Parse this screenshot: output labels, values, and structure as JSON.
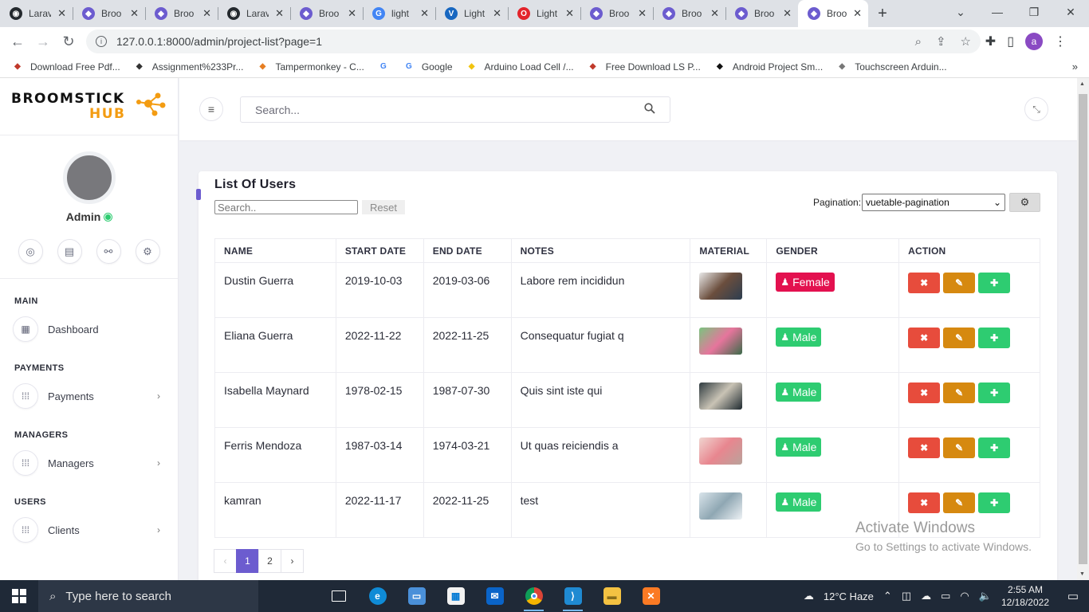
{
  "browser": {
    "tabs": [
      {
        "title": "Larav",
        "icon": "github-icon",
        "color": "#24292e"
      },
      {
        "title": "Broo",
        "icon": "broomstick-icon",
        "color": "#6c5ccf"
      },
      {
        "title": "Broo",
        "icon": "broomstick-icon",
        "color": "#6c5ccf"
      },
      {
        "title": "Larav",
        "icon": "github-icon",
        "color": "#24292e"
      },
      {
        "title": "Broo",
        "icon": "broomstick-icon",
        "color": "#6c5ccf"
      },
      {
        "title": "light",
        "icon": "google-icon",
        "color": "#4285f4"
      },
      {
        "title": "Light",
        "icon": "vuetify-icon",
        "color": "#1867c0"
      },
      {
        "title": "Light",
        "icon": "opera-icon",
        "color": "#e3242b"
      },
      {
        "title": "Broo",
        "icon": "broomstick-icon",
        "color": "#6c5ccf"
      },
      {
        "title": "Broo",
        "icon": "broomstick-icon",
        "color": "#6c5ccf"
      },
      {
        "title": "Broo",
        "icon": "broomstick-icon",
        "color": "#6c5ccf"
      },
      {
        "title": "Broo",
        "icon": "broomstick-icon",
        "color": "#6c5ccf",
        "active": true
      }
    ],
    "url": "127.0.0.1:8000/admin/project-list?page=1",
    "profile_initial": "a",
    "bookmarks": [
      {
        "label": "Download Free Pdf...",
        "icon": "pdf-icon",
        "color": "#c0392b"
      },
      {
        "label": "Assignment%233Pr...",
        "icon": "globe-icon",
        "color": "#333333"
      },
      {
        "label": "Tampermonkey - C...",
        "icon": "tampermonkey-icon",
        "color": "#e67e22"
      },
      {
        "label": "",
        "icon": "google-icon",
        "color": "#4285f4"
      },
      {
        "label": "Google",
        "icon": "google-icon",
        "color": "#4285f4"
      },
      {
        "label": "Arduino Load Cell /...",
        "icon": "arduino-icon",
        "color": "#f1c40f"
      },
      {
        "label": "Free Download LS P...",
        "icon": "ls-icon",
        "color": "#c0392b"
      },
      {
        "label": "Android Project Sm...",
        "icon": "android-icon",
        "color": "#111111"
      },
      {
        "label": "Touchscreen Arduin...",
        "icon": "touchscreen-icon",
        "color": "#777777"
      }
    ]
  },
  "app": {
    "logo_line1": "BROOMSTICK",
    "logo_line2": "HUB",
    "brand_orange": "#f39c12",
    "accent": "#6c5ccf",
    "user_name": "Admin",
    "top_search_placeholder": "Search...",
    "menu": [
      {
        "section": "MAIN",
        "items": [
          {
            "label": "Dashboard",
            "icon": "dashboard-icon",
            "chevron": false
          }
        ]
      },
      {
        "section": "PAYMENTS",
        "items": [
          {
            "label": "Payments",
            "icon": "grid-icon",
            "chevron": true
          }
        ]
      },
      {
        "section": "MANAGERS",
        "items": [
          {
            "label": "Managers",
            "icon": "grid-icon",
            "chevron": true
          }
        ]
      },
      {
        "section": "USERS",
        "items": [
          {
            "label": "Clients",
            "icon": "grid-icon",
            "chevron": true
          }
        ]
      }
    ]
  },
  "card": {
    "title": "List Of Users",
    "search_placeholder": "Search..",
    "reset_label": "Reset",
    "pagination_label": "Pagination:",
    "pagination_value": "vuetable-pagination",
    "columns": [
      "NAME",
      "START DATE",
      "END DATE",
      "NOTES",
      "MATERIAL",
      "GENDER",
      "ACTION"
    ],
    "rows": [
      {
        "name": "Dustin Guerra",
        "start": "2019-10-03",
        "end": "2019-03-06",
        "notes": "Labore rem incididun",
        "gender": "Female",
        "gender_color": "#e3114f",
        "thumb": [
          "#e9e9e9",
          "#6b4e3d",
          "#2c3e50"
        ]
      },
      {
        "name": "Eliana Guerra",
        "start": "2022-11-22",
        "end": "2022-11-25",
        "notes": "Consequatur fugiat q",
        "gender": "Male",
        "gender_color": "#2ecc71",
        "thumb": [
          "#7ac47f",
          "#e6759c",
          "#3b6b4a"
        ]
      },
      {
        "name": "Isabella Maynard",
        "start": "1978-02-15",
        "end": "1987-07-30",
        "notes": "Quis sint iste qui",
        "gender": "Male",
        "gender_color": "#2ecc71",
        "thumb": [
          "#2f3b40",
          "#c9c3b5",
          "#1e2a30"
        ]
      },
      {
        "name": "Ferris Mendoza",
        "start": "1987-03-14",
        "end": "1974-03-21",
        "notes": "Ut quas reiciendis a",
        "gender": "Male",
        "gender_color": "#2ecc71",
        "thumb": [
          "#f0d5d0",
          "#e8868f",
          "#b9a39b"
        ]
      },
      {
        "name": "kamran",
        "start": "2022-11-17",
        "end": "2022-11-25",
        "notes": "test",
        "gender": "Male",
        "gender_color": "#2ecc71",
        "thumb": [
          "#d9e4ea",
          "#8fa7b3",
          "#eef2f5"
        ]
      }
    ],
    "pages": [
      "‹",
      "1",
      "2",
      "›"
    ],
    "current_page": "1"
  },
  "watermark": {
    "line1": "Activate Windows",
    "line2": "Go to Settings to activate Windows."
  },
  "taskbar": {
    "search_placeholder": "Type here to search",
    "weather": "12°C  Haze",
    "time": "2:55 AM",
    "date": "12/18/2022"
  }
}
